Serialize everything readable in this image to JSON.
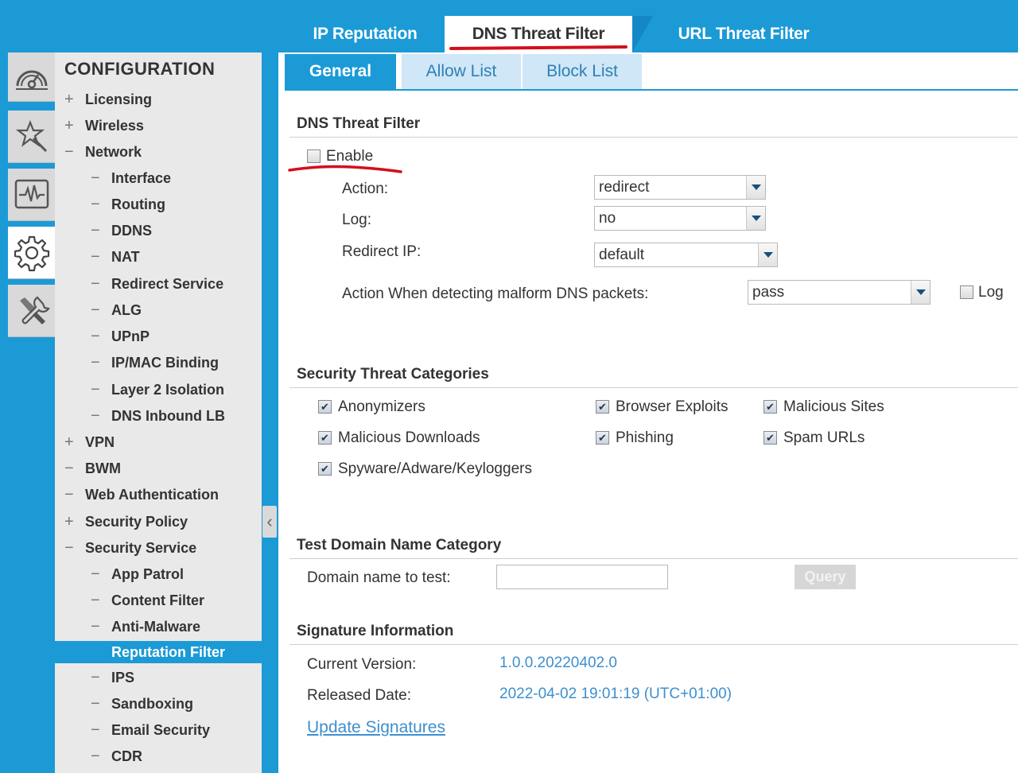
{
  "top_tabs": [
    {
      "label": "IP Reputation"
    },
    {
      "label": "DNS Threat Filter"
    },
    {
      "label": "URL Threat Filter"
    }
  ],
  "rail_icons": [
    "dashboard-icon",
    "quick-setup-wand-icon",
    "monitor-icon",
    "gear-icon",
    "maintenance-tools-icon"
  ],
  "nav": {
    "title": "CONFIGURATION",
    "items": [
      {
        "sym": "+",
        "label": "Licensing"
      },
      {
        "sym": "+",
        "label": "Wireless"
      },
      {
        "sym": "−",
        "label": "Network"
      },
      {
        "sym": "−",
        "label": "Interface"
      },
      {
        "sym": "−",
        "label": "Routing"
      },
      {
        "sym": "−",
        "label": "DDNS"
      },
      {
        "sym": "−",
        "label": "NAT"
      },
      {
        "sym": "−",
        "label": "Redirect Service"
      },
      {
        "sym": "−",
        "label": "ALG"
      },
      {
        "sym": "−",
        "label": "UPnP"
      },
      {
        "sym": "−",
        "label": "IP/MAC Binding"
      },
      {
        "sym": "−",
        "label": "Layer 2 Isolation"
      },
      {
        "sym": "−",
        "label": "DNS Inbound LB"
      },
      {
        "sym": "+",
        "label": "VPN"
      },
      {
        "sym": "−",
        "label": "BWM"
      },
      {
        "sym": "−",
        "label": "Web Authentication"
      },
      {
        "sym": "+",
        "label": "Security Policy"
      },
      {
        "sym": "−",
        "label": "Security Service"
      },
      {
        "sym": "−",
        "label": "App Patrol"
      },
      {
        "sym": "−",
        "label": "Content Filter"
      },
      {
        "sym": "−",
        "label": "Anti-Malware"
      },
      {
        "sym": "−",
        "label": "Reputation Filter"
      },
      {
        "sym": "−",
        "label": "IPS"
      },
      {
        "sym": "−",
        "label": "Sandboxing"
      },
      {
        "sym": "−",
        "label": "Email Security"
      },
      {
        "sym": "−",
        "label": "CDR"
      }
    ]
  },
  "sub_tabs": [
    {
      "label": "General"
    },
    {
      "label": "Allow List"
    },
    {
      "label": "Block List"
    }
  ],
  "dns_filter": {
    "section_title": "DNS Threat Filter",
    "enable_label": "Enable",
    "enable_checked": false,
    "action_label": "Action:",
    "action_value": "redirect",
    "log_label": "Log:",
    "log_value": "no",
    "redirect_ip_label": "Redirect IP:",
    "redirect_ip_value": "default",
    "malform_label": "Action When detecting malform DNS packets:",
    "malform_value": "pass",
    "malform_log_label": "Log",
    "malform_log_checked": false
  },
  "categories": {
    "section_title": "Security Threat Categories",
    "items": [
      {
        "label": "Anonymizers",
        "checked": true
      },
      {
        "label": "Browser Exploits",
        "checked": true
      },
      {
        "label": "Malicious Sites",
        "checked": true
      },
      {
        "label": "Malicious Downloads",
        "checked": true
      },
      {
        "label": "Phishing",
        "checked": true
      },
      {
        "label": "Spam URLs",
        "checked": true
      },
      {
        "label": "Spyware/Adware/Keyloggers",
        "checked": true
      }
    ]
  },
  "test_domain": {
    "section_title": "Test Domain Name Category",
    "label": "Domain name to test:",
    "value": "",
    "query_label": "Query"
  },
  "signature": {
    "section_title": "Signature Information",
    "current_version_label": "Current Version:",
    "current_version": "1.0.0.20220402.0",
    "released_date_label": "Released Date:",
    "released_date": "2022-04-02 19:01:19 (UTC+01:00)",
    "update_label": "Update Signatures"
  },
  "colors": {
    "brand_blue": "#1b9ad6",
    "annotation_red": "#d40f1c",
    "link_blue": "#3d8fcf"
  }
}
